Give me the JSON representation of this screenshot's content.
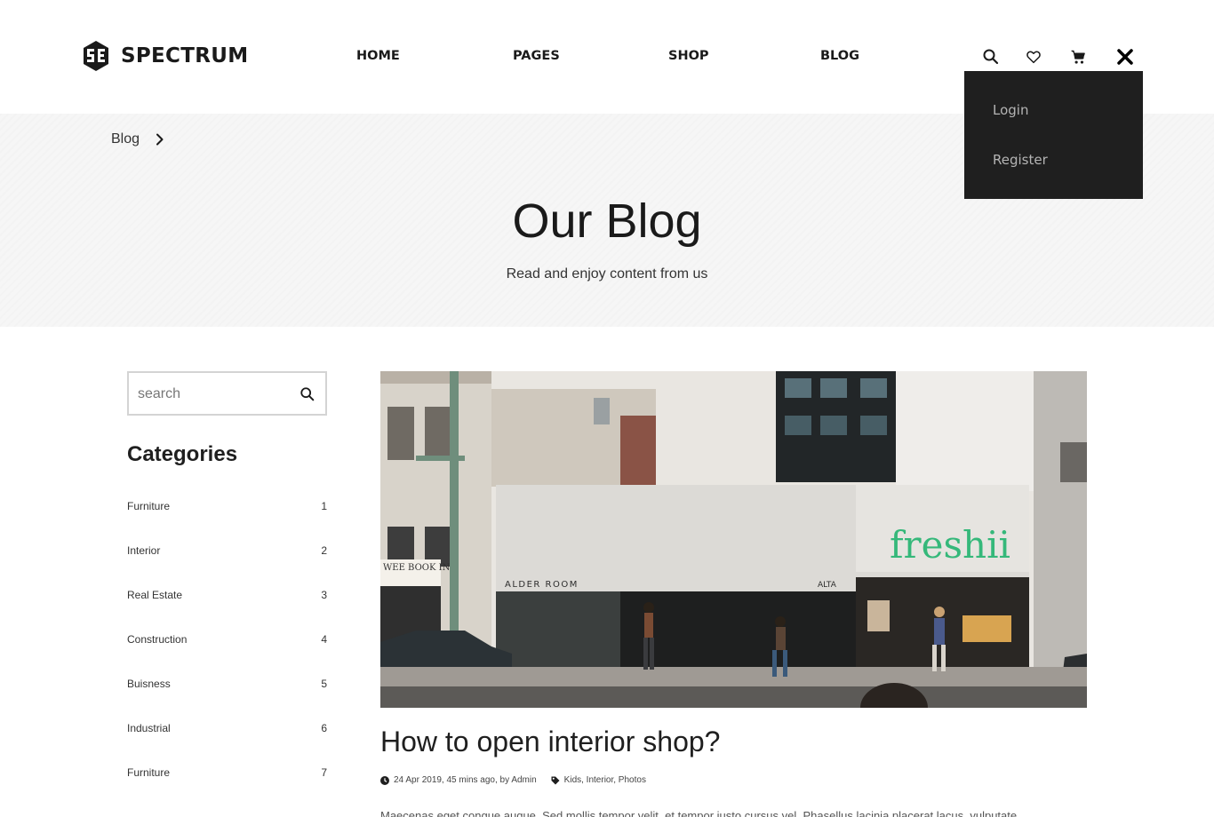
{
  "brand": {
    "name": "SPECTRUM",
    "logo_icon": "spectrum-logo-icon"
  },
  "nav": {
    "items": [
      {
        "label": "HOME"
      },
      {
        "label": "PAGES"
      },
      {
        "label": "SHOP"
      },
      {
        "label": "BLOG"
      }
    ]
  },
  "header_icons": {
    "search": "search-icon",
    "wishlist": "heart-icon",
    "cart": "cart-icon",
    "close": "close-icon"
  },
  "account_menu": {
    "items": [
      {
        "label": "Login"
      },
      {
        "label": "Register"
      }
    ]
  },
  "banner": {
    "breadcrumb": {
      "label": "Blog",
      "separator_icon": "chevron-right-icon"
    },
    "title": "Our Blog",
    "subtitle": "Read and enjoy content from us"
  },
  "sidebar": {
    "search": {
      "placeholder": "search",
      "value": "",
      "icon": "search-icon"
    },
    "categories_title": "Categories",
    "categories": [
      {
        "name": "Furniture",
        "count": "1"
      },
      {
        "name": "Interior",
        "count": "2"
      },
      {
        "name": "Real Estate",
        "count": "3"
      },
      {
        "name": "Construction",
        "count": "4"
      },
      {
        "name": "Buisness",
        "count": "5"
      },
      {
        "name": "Industrial",
        "count": "6"
      },
      {
        "name": "Furniture",
        "count": "7"
      }
    ]
  },
  "post": {
    "image_signs": {
      "store_left": "ALDER ROOM",
      "store_mid": "ALTA",
      "brand_sign": "freshii",
      "side_sign": "WEE BOOK INN"
    },
    "title": "How to open interior shop?",
    "meta": {
      "date_author": "24 Apr 2019, 45 mins ago, by Admin",
      "tags": "Kids, Interior, Photos"
    },
    "excerpt": "Maecenas eget congue augue. Sed mollis tempor velit, et tempor justo cursus vel. Phasellus lacinia placerat lacus, vulputate"
  },
  "colors": {
    "dropdown_bg": "#1f1f1f",
    "banner_bg": "#f6f6f6",
    "sign_green": "#35b87a",
    "text_dark": "#1f1f1f"
  }
}
